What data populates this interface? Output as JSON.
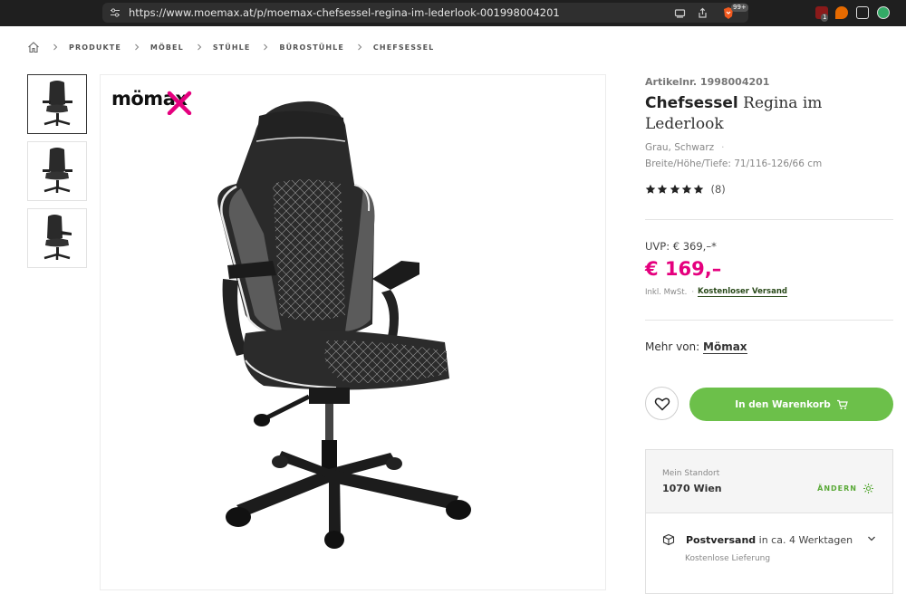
{
  "browser": {
    "url": "https://www.moemax.at/p/moemax-chefsessel-regina-im-lederlook-001998004201",
    "extension_badges": [
      "99+",
      "1"
    ]
  },
  "breadcrumb": [
    "PRODUKTE",
    "MÖBEL",
    "STÜHLE",
    "BÜROSTÜHLE",
    "CHEFSESSEL"
  ],
  "logo": {
    "text": "mömax",
    "accent_color": "#e5007e"
  },
  "product": {
    "article_number": "Artikelnr. 1998004201",
    "brand_title": "Chefsessel",
    "title_rest": "Regina im Lederlook",
    "colors": "Grau, Schwarz",
    "dimensions": "Breite/Höhe/Tiefe: 71/116-126/66 cm",
    "rating": 5,
    "reviews": "(8)",
    "uvp": "UVP: € 369,–*",
    "price": "€ 169,–",
    "vat": "Inkl. MwSt.",
    "shipping_free": "Kostenloser Versand",
    "more_from_label": "Mehr von:",
    "more_from_brand": "Mömax",
    "add_to_cart": "In den Warenkorb"
  },
  "store": {
    "label": "Mein Standort",
    "name": "1070 Wien",
    "change": "ÄNDERN",
    "shipping_title": "Postversand",
    "shipping_time": "in ca. 4 Werktagen",
    "shipping_sub": "Kostenlose Lieferung"
  },
  "colors": {
    "price": "#e5007e",
    "cart_button": "#6cc04a",
    "link_green": "#5aa938"
  },
  "icons": [
    "tune-icon",
    "screen-icon",
    "share-icon",
    "brave-shield-icon",
    "home-icon",
    "chevron-right-icon",
    "star-icon",
    "heart-icon",
    "cart-icon",
    "gear-icon",
    "package-icon",
    "chevron-down-icon"
  ]
}
